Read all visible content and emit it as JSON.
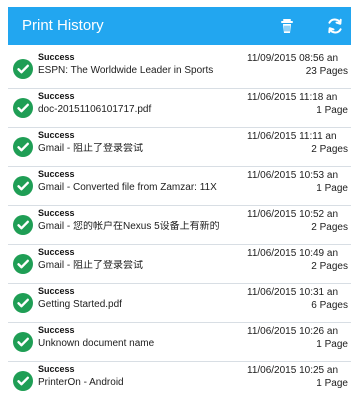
{
  "app_bar": {
    "title": "Print History",
    "actions": {
      "trash_icon": "trash-icon",
      "refresh_icon": "refresh-icon"
    },
    "background_color": "#22a6f0",
    "text_color": "#ffffff"
  },
  "history": {
    "status_color": "#1f9e55",
    "items": [
      {
        "status": "Success",
        "document": "ESPN: The Worldwide Leader in Sports",
        "timestamp": "11/09/2015 08:56 an",
        "pages": "23 Pages"
      },
      {
        "status": "Success",
        "document": "doc-20151106101717.pdf",
        "timestamp": "11/06/2015 11:18 an",
        "pages": "1 Page"
      },
      {
        "status": "Success",
        "document": "Gmail - 阻止了登录尝试",
        "timestamp": "11/06/2015 11:11 an",
        "pages": "2 Pages"
      },
      {
        "status": "Success",
        "document": "Gmail - Converted file from Zamzar: 11X",
        "timestamp": "11/06/2015 10:53 an",
        "pages": "1 Page"
      },
      {
        "status": "Success",
        "document": "Gmail - 您的帐户在Nexus 5设备上有新的",
        "timestamp": "11/06/2015 10:52 an",
        "pages": "2 Pages"
      },
      {
        "status": "Success",
        "document": "Gmail - 阻止了登录尝试",
        "timestamp": "11/06/2015 10:49 an",
        "pages": "2 Pages"
      },
      {
        "status": "Success",
        "document": "Getting Started.pdf",
        "timestamp": "11/06/2015 10:31 an",
        "pages": "6 Pages"
      },
      {
        "status": "Success",
        "document": "Unknown document name",
        "timestamp": "11/06/2015 10:26 an",
        "pages": "1 Page"
      },
      {
        "status": "Success",
        "document": "PrinterOn - Android",
        "timestamp": "11/06/2015 10:25 an",
        "pages": "1 Page"
      }
    ]
  }
}
